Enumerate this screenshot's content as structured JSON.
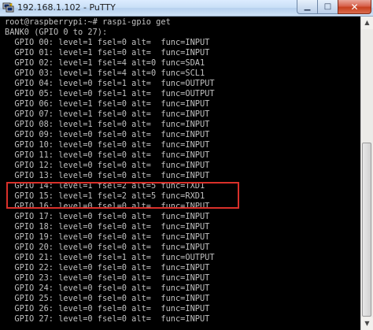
{
  "window": {
    "title": "192.168.1.102 - PuTTY",
    "app_icon": "putty-icon",
    "controls": {
      "minimize_glyph": "▁",
      "maximize_glyph": "□",
      "close_glyph": "✕"
    }
  },
  "terminal": {
    "prompt_line": "root@raspberrypi:~# raspi-gpio get",
    "bank_line": "BANK0 (GPIO 0 to 27):",
    "gpio_lines": [
      "  GPIO 00: level=1 fsel=0 alt=  func=INPUT",
      "  GPIO 01: level=1 fsel=0 alt=  func=INPUT",
      "  GPIO 02: level=1 fsel=4 alt=0 func=SDA1",
      "  GPIO 03: level=1 fsel=4 alt=0 func=SCL1",
      "  GPIO 04: level=0 fsel=1 alt=  func=OUTPUT",
      "  GPIO 05: level=0 fsel=1 alt=  func=OUTPUT",
      "  GPIO 06: level=1 fsel=0 alt=  func=INPUT",
      "  GPIO 07: level=1 fsel=0 alt=  func=INPUT",
      "  GPIO 08: level=1 fsel=0 alt=  func=INPUT",
      "  GPIO 09: level=0 fsel=0 alt=  func=INPUT",
      "  GPIO 10: level=0 fsel=0 alt=  func=INPUT",
      "  GPIO 11: level=0 fsel=0 alt=  func=INPUT",
      "  GPIO 12: level=0 fsel=0 alt=  func=INPUT",
      "  GPIO 13: level=0 fsel=0 alt=  func=INPUT",
      "  GPIO 14: level=1 fsel=2 alt=5 func=TXD1",
      "  GPIO 15: level=1 fsel=2 alt=5 func=RXD1",
      "  GPIO 16: level=0 fsel=0 alt=  func=INPUT",
      "  GPIO 17: level=0 fsel=0 alt=  func=INPUT",
      "  GPIO 18: level=0 fsel=0 alt=  func=INPUT",
      "  GPIO 19: level=0 fsel=0 alt=  func=INPUT",
      "  GPIO 20: level=0 fsel=0 alt=  func=INPUT",
      "  GPIO 21: level=0 fsel=1 alt=  func=OUTPUT",
      "  GPIO 22: level=0 fsel=0 alt=  func=INPUT",
      "  GPIO 23: level=0 fsel=0 alt=  func=INPUT",
      "  GPIO 24: level=0 fsel=0 alt=  func=INPUT",
      "  GPIO 25: level=0 fsel=0 alt=  func=INPUT",
      "  GPIO 26: level=0 fsel=0 alt=  func=INPUT",
      "  GPIO 27: level=0 fsel=0 alt=  func=INPUT"
    ],
    "highlighted_rows": [
      "GPIO 14",
      "GPIO 15"
    ],
    "colors": {
      "background": "#000000",
      "foreground": "#c0c0c0",
      "highlight_border": "#d9302a"
    }
  },
  "scrollbar": {
    "up_glyph": "▲",
    "down_glyph": "▼"
  }
}
